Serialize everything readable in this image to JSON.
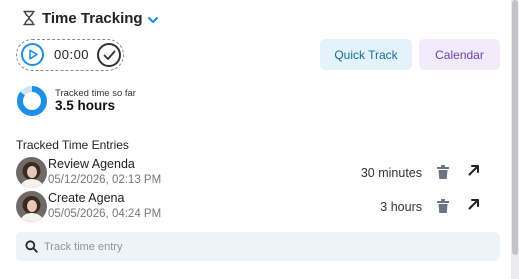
{
  "header": {
    "title": "Time Tracking",
    "icon": "hourglass-icon",
    "dropdown_icon": "chevron-down-icon"
  },
  "timer": {
    "time": "00:00"
  },
  "buttons": {
    "quick_track": "Quick Track",
    "calendar": "Calendar"
  },
  "summary": {
    "label": "Tracked time so far",
    "value": "3.5 hours",
    "progress_percent": 85,
    "accent": "#1f8ee8"
  },
  "entries_section": {
    "title": "Tracked Time Entries"
  },
  "entries": [
    {
      "name": "Review Agenda",
      "date": "05/12/2026, 02:13 PM",
      "duration": "30 minutes"
    },
    {
      "name": "Create Agena",
      "date": "05/05/2026, 04:24 PM",
      "duration": "3 hours"
    }
  ],
  "search": {
    "placeholder": "Track time entry"
  },
  "colors": {
    "accent_blue": "#1f8ee8",
    "quick_bg": "#e4f3fb",
    "calendar_bg": "#f1ebfb",
    "calendar_text": "#6a3fb0"
  }
}
